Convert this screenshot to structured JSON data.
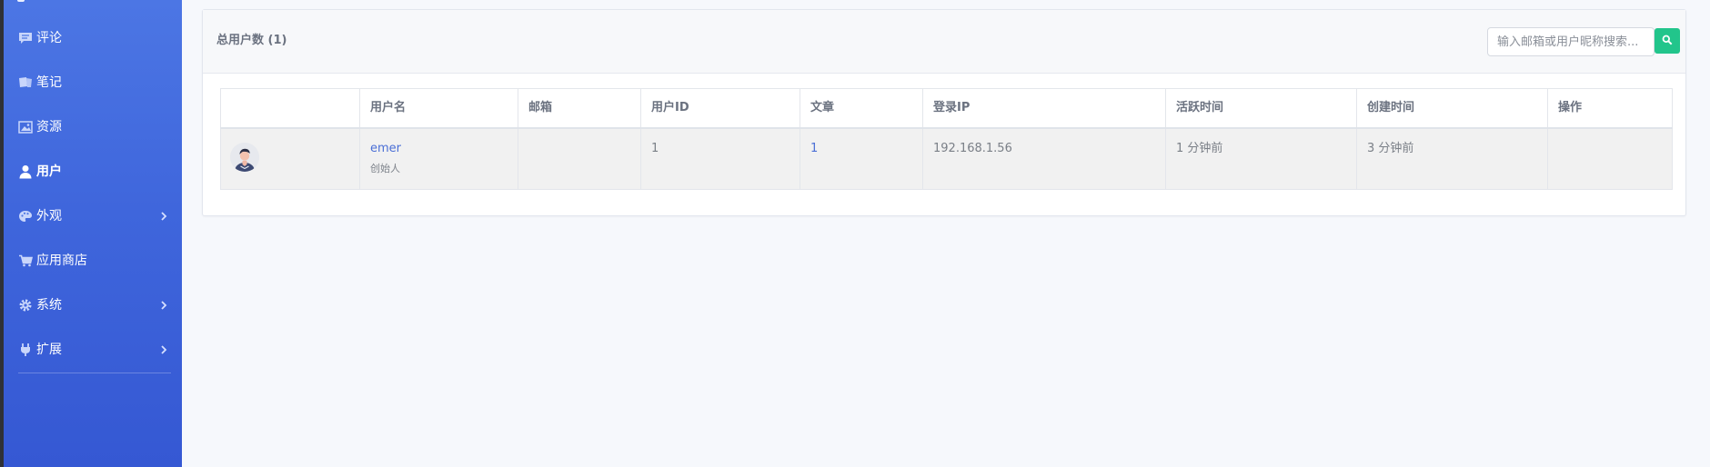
{
  "sidebar": {
    "items": [
      {
        "label": "评论",
        "icon": "comment-icon"
      },
      {
        "label": "笔记",
        "icon": "notes-icon"
      },
      {
        "label": "资源",
        "icon": "image-icon"
      },
      {
        "label": "用户",
        "icon": "user-icon",
        "active": true
      },
      {
        "label": "外观",
        "icon": "palette-icon",
        "has_submenu": true
      },
      {
        "label": "应用商店",
        "icon": "cart-icon"
      },
      {
        "label": "系统",
        "icon": "gear-icon",
        "has_submenu": true
      },
      {
        "label": "扩展",
        "icon": "plug-icon",
        "has_submenu": true
      }
    ]
  },
  "panel": {
    "title": "总用户数 (1)",
    "search_placeholder": "输入邮箱或用户昵称搜索...",
    "search_button_icon": "search-icon"
  },
  "table": {
    "headers": [
      "",
      "用户名",
      "邮箱",
      "用户ID",
      "文章",
      "登录IP",
      "活跃时间",
      "创建时间",
      "操作"
    ],
    "rows": [
      {
        "avatar": "avatar",
        "username": "emer",
        "role": "创始人",
        "email": "",
        "user_id": "1",
        "articles": "1",
        "login_ip": "192.168.1.56",
        "active_time": "1 分钟前",
        "created_time": "3 分钟前",
        "actions": ""
      }
    ]
  },
  "colors": {
    "sidebar_top": "#4c76e4",
    "sidebar_bottom": "#3558d3",
    "search_button": "#22c58b",
    "link": "#4b6fd6"
  }
}
